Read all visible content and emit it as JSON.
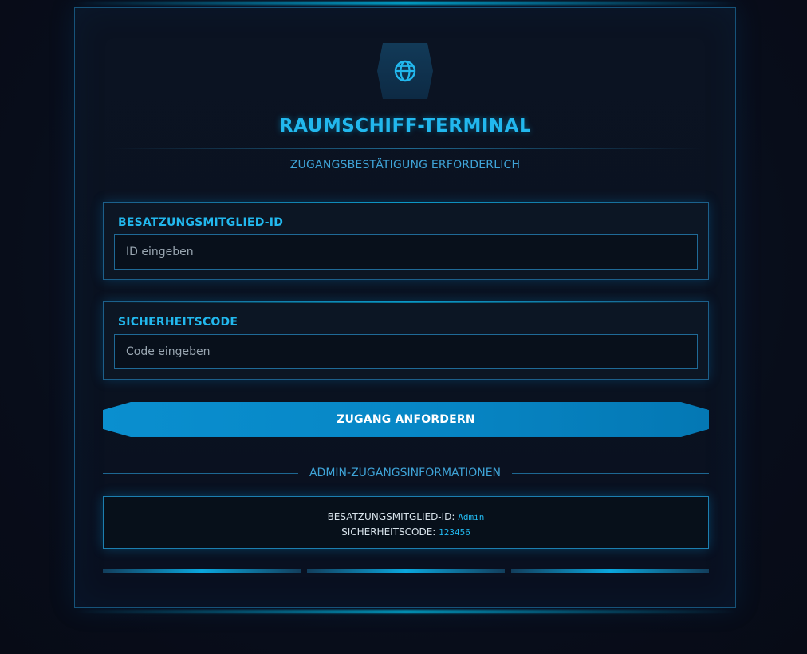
{
  "header": {
    "logo_icon": "globe-icon",
    "title": "RAUMSCHIFF-TERMINAL",
    "subtitle": "ZUGANGSBESTÄTIGUNG ERFORDERLICH"
  },
  "form": {
    "crew_id": {
      "label": "BESATZUNGSMITGLIED-ID",
      "value": "",
      "placeholder": "ID eingeben"
    },
    "security_code": {
      "label": "SICHERHEITSCODE",
      "value": "",
      "placeholder": "Code eingeben"
    },
    "submit_label": "ZUGANG ANFORDERN"
  },
  "admin_info": {
    "heading": "ADMIN-ZUGANGSINFORMATIONEN",
    "id_label": "BESATZUNGSMITGLIED-ID:",
    "id_value": "Admin",
    "code_label": "SICHERHEITSCODE:",
    "code_value": "123456"
  },
  "colors": {
    "accent": "#22b8ee",
    "button": "#0787c6",
    "background": "#0a1020"
  }
}
